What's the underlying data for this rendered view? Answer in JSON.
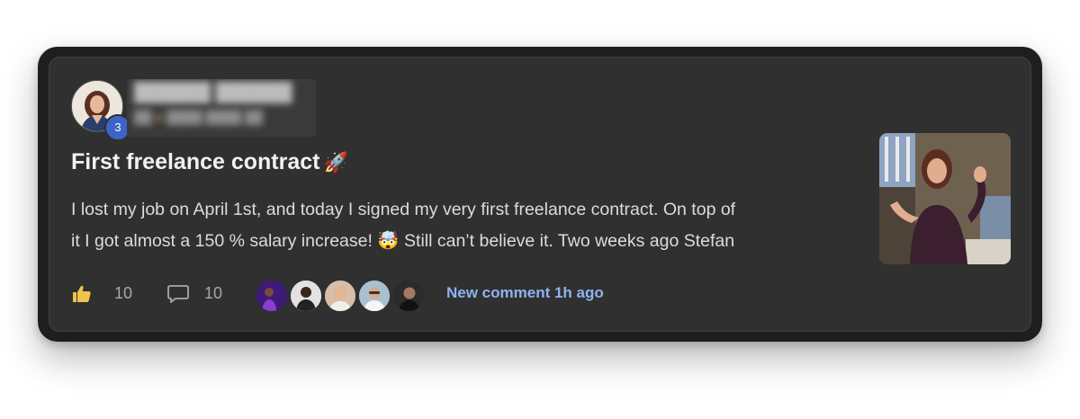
{
  "post": {
    "author": {
      "level": "3",
      "avatar_icon": "user-photo-icon"
    },
    "title": "First freelance contract",
    "title_emoji": "🚀",
    "body_lines": [
      "I lost my job on April 1st, and today I signed my very first freelance contract. On top of",
      "it I got almost a 150 % salary increase! 🤯 Still can’t believe it. Two weeks ago Stefan"
    ],
    "likes": "10",
    "comments": "10",
    "commenters_count": 5,
    "new_comment_label": "New comment 1h ago",
    "thumbnail_icon": "celebration-gif-icon"
  },
  "colors": {
    "card_bg": "#303030",
    "card_frame": "#1e1e1e",
    "accent_link": "#8fb3ef",
    "badge": "#3d64c7",
    "title": "#f1f1f1",
    "body": "#dcdcdc",
    "muted": "#a8a8a8"
  }
}
